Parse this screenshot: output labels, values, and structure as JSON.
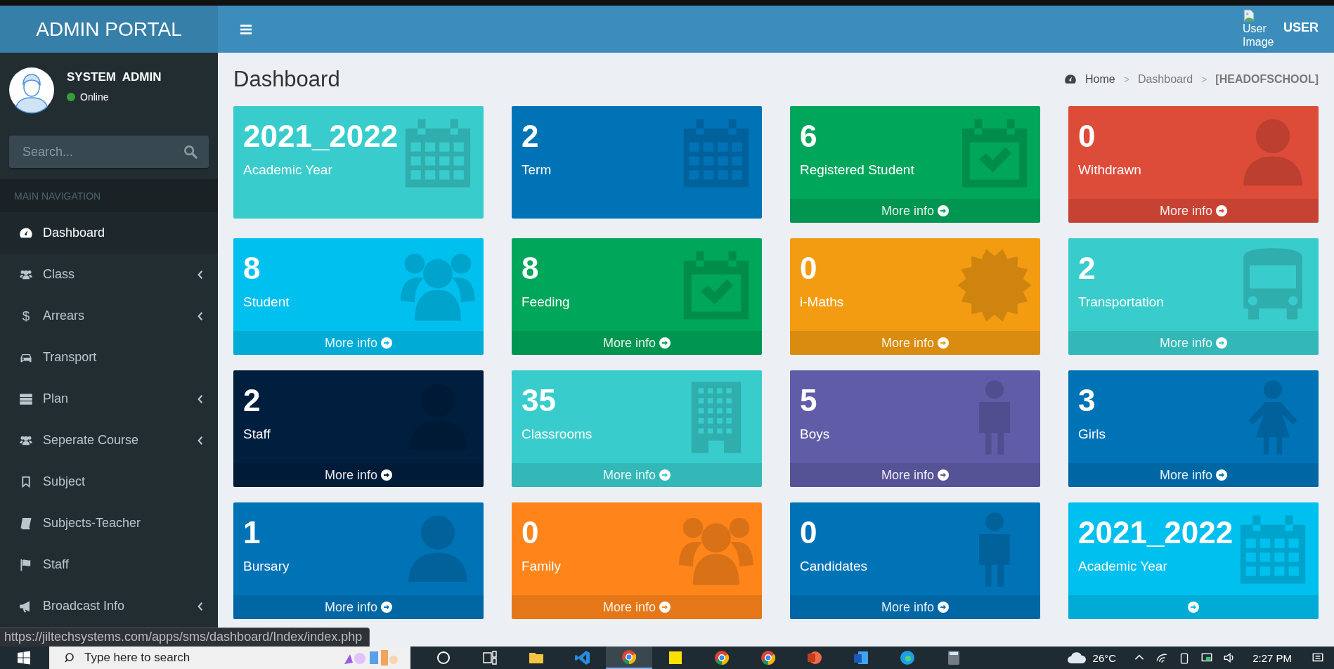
{
  "header": {
    "brand": "ADMIN PORTAL",
    "user_image_alt": "User Image",
    "user_name": "USER"
  },
  "sidebar": {
    "user_name": "SYSTEM  ADMIN",
    "status": "Online",
    "search": {
      "placeholder": "Search..."
    },
    "nav_header": "MAIN NAVIGATION",
    "items": [
      {
        "label": "Dashboard",
        "selected": true,
        "has_submenu": false
      },
      {
        "label": "Class",
        "selected": false,
        "has_submenu": true
      },
      {
        "label": "Arrears",
        "icon_text": "$",
        "selected": false,
        "has_submenu": true
      },
      {
        "label": "Transport",
        "selected": false,
        "has_submenu": false
      },
      {
        "label": "Plan",
        "selected": false,
        "has_submenu": true
      },
      {
        "label": "Seperate Course",
        "selected": false,
        "has_submenu": true
      },
      {
        "label": "Subject",
        "selected": false,
        "has_submenu": false
      },
      {
        "label": "Subjects-Teacher",
        "selected": false,
        "has_submenu": false
      },
      {
        "label": "Staff",
        "selected": false,
        "has_submenu": false
      },
      {
        "label": "Broadcast Info",
        "selected": false,
        "has_submenu": true
      }
    ]
  },
  "page_title": "Dashboard",
  "breadcrumb": [
    {
      "kind": "link",
      "text": "Home"
    },
    {
      "kind": "separator",
      "text": ">"
    },
    {
      "kind": "link",
      "text": "Dashboard"
    },
    {
      "kind": "separator",
      "text": ">"
    },
    {
      "kind": "current",
      "text": "[HEADOFSCHOOL]"
    }
  ],
  "cards": [
    {
      "value": "2021_2022",
      "label": "Academic Year",
      "color": "#39cccc",
      "footer": false
    },
    {
      "value": "2",
      "label": "Term",
      "color": "#0073b7",
      "footer": false
    },
    {
      "value": "6",
      "label": "Registered Student",
      "color": "#00a65a",
      "footer": true,
      "footer_text": "More info"
    },
    {
      "value": "0",
      "label": "Withdrawn",
      "color": "#dd4b39",
      "footer": true,
      "footer_text": "More info"
    },
    {
      "value": "8",
      "label": "Student",
      "color": "#00c0ef",
      "footer": true,
      "footer_text": "More info"
    },
    {
      "value": "8",
      "label": "Feeding",
      "color": "#00a65a",
      "footer": true,
      "footer_text": "More info"
    },
    {
      "value": "0",
      "label": "i-Maths",
      "color": "#f39c12",
      "footer": true,
      "footer_text": "More info"
    },
    {
      "value": "2",
      "label": "Transportation",
      "color": "#39cccc",
      "footer": true,
      "footer_text": "More info"
    },
    {
      "value": "2",
      "label": "Staff",
      "color": "#001f3f",
      "footer": true,
      "footer_text": "More info"
    },
    {
      "value": "35",
      "label": "Classrooms",
      "color": "#39cccc",
      "footer": true,
      "footer_text": "More info"
    },
    {
      "value": "5",
      "label": "Boys",
      "color": "#605ca8",
      "footer": true,
      "footer_text": "More info"
    },
    {
      "value": "3",
      "label": "Girls",
      "color": "#0073b7",
      "footer": true,
      "footer_text": "More info"
    },
    {
      "value": "1",
      "label": "Bursary",
      "color": "#0073b7",
      "footer": true,
      "footer_text": "More info"
    },
    {
      "value": "0",
      "label": "Family",
      "color": "#ff851b",
      "footer": true,
      "footer_text": "More info"
    },
    {
      "value": "0",
      "label": "Candidates",
      "color": "#0073b7",
      "footer": true,
      "footer_text": "More info"
    },
    {
      "value": "2021_2022",
      "label": "Academic Year",
      "color": "#00c0ef",
      "footer": true
    }
  ],
  "status_url": "https://jiltechsystems.com/apps/sms/dashboard/Index/index.php",
  "taskbar": {
    "search_placeholder": "Type here to search",
    "apps": [
      {
        "selected": false
      },
      {
        "selected": false
      },
      {
        "selected": false
      },
      {
        "selected": false
      },
      {
        "selected": true
      },
      {
        "selected": false
      },
      {
        "selected": false
      },
      {
        "selected": false
      },
      {
        "selected": false
      },
      {
        "selected": false
      },
      {
        "selected": false
      },
      {
        "selected": false
      }
    ],
    "weather": "26°C",
    "time": "2:27 PM"
  }
}
